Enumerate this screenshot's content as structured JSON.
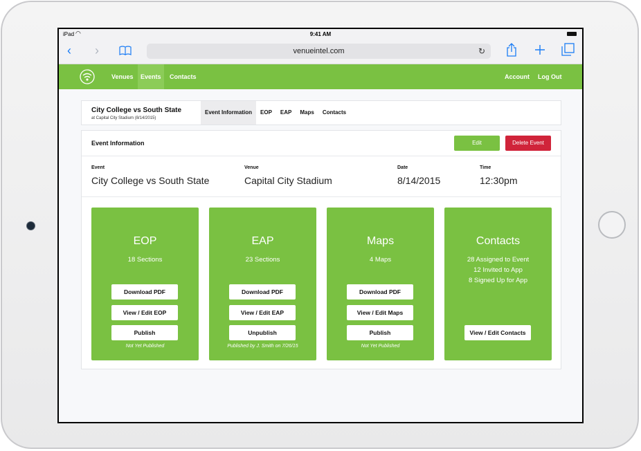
{
  "status_bar": {
    "carrier": "iPad",
    "time": "9:41 AM"
  },
  "browser": {
    "url": "venueintel.com"
  },
  "nav": {
    "items": [
      "Venues",
      "Events",
      "Contacts"
    ],
    "active": "Events",
    "right": [
      "Account",
      "Log Out"
    ]
  },
  "event_header": {
    "title": "City College vs South State",
    "subtitle": "at Capital City Stadium (8/14/2015)",
    "tabs": [
      "Event Information",
      "EOP",
      "EAP",
      "Maps",
      "Contacts"
    ],
    "active_tab": "Event Information"
  },
  "event_info": {
    "heading": "Event Information",
    "edit_label": "Edit",
    "delete_label": "Delete Event",
    "fields": [
      {
        "label": "Event",
        "value": "City College vs South State"
      },
      {
        "label": "Venue",
        "value": "Capital City Stadium"
      },
      {
        "label": "Date",
        "value": "8/14/2015"
      },
      {
        "label": "Time",
        "value": "12:30pm"
      }
    ]
  },
  "cards": [
    {
      "title": "EOP",
      "lines": [
        "18 Sections"
      ],
      "buttons": [
        "Download PDF",
        "View / Edit EOP",
        "Publish"
      ],
      "note": "Not Yet Published"
    },
    {
      "title": "EAP",
      "lines": [
        "23 Sections"
      ],
      "buttons": [
        "Download PDF",
        "View / Edit EAP",
        "Unpublish"
      ],
      "note": "Published by J. Smith on 7/26/15"
    },
    {
      "title": "Maps",
      "lines": [
        "4 Maps"
      ],
      "buttons": [
        "Download PDF",
        "View / Edit Maps",
        "Publish"
      ],
      "note": "Not Yet Published"
    },
    {
      "title": "Contacts",
      "lines": [
        "28 Assigned to Event",
        "12 Invited to App",
        "8 Signed Up for App"
      ],
      "buttons": [
        "View / Edit Contacts"
      ],
      "note": ""
    }
  ],
  "colors": {
    "brand_green": "#7ac142",
    "danger_red": "#d0243a",
    "safari_blue": "#1a7cf5"
  },
  "icons": [
    "wifi-icon",
    "back-icon",
    "forward-icon",
    "bookmarks-icon",
    "reload-icon",
    "share-icon",
    "add-tab-icon",
    "tabs-icon",
    "brand-logo-icon"
  ]
}
